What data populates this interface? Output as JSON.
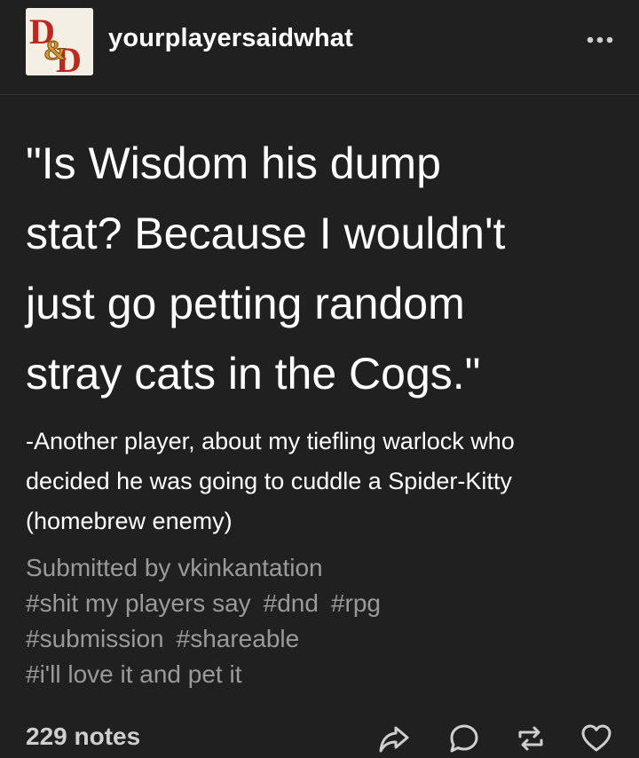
{
  "post": {
    "blog_name": "yourplayersaidwhat",
    "avatar_icon": "dnd-ampersand-logo",
    "more_icon": "ellipsis-icon",
    "quote_lines": [
      "\"Is Wisdom his dump",
      "stat? Because I wouldn't",
      "just go petting random",
      "stray cats in the Cogs.\""
    ],
    "body_lines": [
      "-Another player, about my tiefling warlock who",
      "decided he was going to cuddle a Spider-Kitty",
      "(homebrew enemy)"
    ],
    "submitted_by": "Submitted by vkinkantation",
    "tags": {
      "shit_my_players_say": "#shit my players say",
      "dnd": "#dnd",
      "rpg": "#rpg",
      "submission": "#submission",
      "shareable": "#shareable",
      "ill_love_it": "#i'll love it and pet it"
    }
  },
  "footer": {
    "notes": "229 notes",
    "actions": [
      "share-icon",
      "reply-icon",
      "reblog-icon",
      "like-icon"
    ]
  },
  "colors": {
    "background": "#202020",
    "text": "#ffffff",
    "tag_text": "#9a9a9a",
    "divider": "#363636"
  }
}
